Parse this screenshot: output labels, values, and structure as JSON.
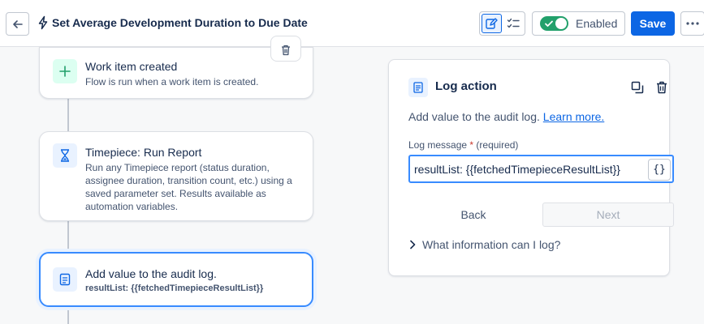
{
  "header": {
    "title": "Set Average Development Duration to Due Date",
    "enabled_label": "Enabled",
    "save_label": "Save"
  },
  "cards": [
    {
      "title": "Work item created",
      "description": "Flow is run when a work item is created.",
      "icon": "plus-icon",
      "icon_bg": "#dcfff1",
      "icon_color": "#22a06b"
    },
    {
      "title": "Timepiece: Run Report",
      "description": "Run any Timepiece report (status duration, assignee duration, transition count, etc.) using a saved parameter set. Results available as automation variables.",
      "icon": "hourglass-icon",
      "icon_bg": "#e9f2ff",
      "icon_color": "#0c66e4"
    },
    {
      "title": "Add value to the audit log.",
      "code": "resultList: {{fetchedTimepieceResultList}}",
      "icon": "log-icon",
      "icon_bg": "#e9f2ff",
      "icon_color": "#0c66e4"
    }
  ],
  "panel": {
    "title": "Log action",
    "description": "Add value to the audit log.",
    "learn_more": "Learn more.",
    "field_label": "Log message",
    "field_required_mark": "*",
    "field_required_text": "(required)",
    "field_value": "resultList: {{fetchedTimepieceResultList}}",
    "brace_button": "{}",
    "back_label": "Back",
    "next_label": "Next",
    "expander_label": "What information can I log?"
  },
  "colors": {
    "accent": "#0c66e4",
    "enabled_green": "#22a06b",
    "selected_border": "#388bff"
  }
}
